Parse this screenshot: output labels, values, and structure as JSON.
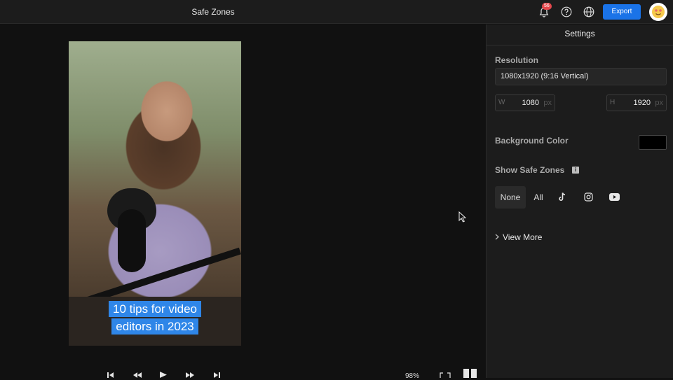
{
  "window": {
    "title": "Safe Zones"
  },
  "topbar": {
    "notification_count": "56",
    "export_label": "Export",
    "icons": [
      "bell-icon",
      "help-icon",
      "globe-icon"
    ],
    "accent_color": "#1a73e8"
  },
  "video": {
    "caption_line1": "10 tips for video",
    "caption_line2": "editors in 2023"
  },
  "playback": {
    "zoom": "98%"
  },
  "settings": {
    "header": "Settings",
    "resolution_label": "Resolution",
    "resolution_value": "1080x1920 (9:16 Vertical)",
    "width_prefix": "W",
    "width_value": "1080",
    "height_prefix": "H",
    "height_value": "1920",
    "unit": "px",
    "background_color_label": "Background Color",
    "background_color": "#000000",
    "safe_zones_label": "Show Safe Zones",
    "zone_options": [
      "None",
      "All"
    ],
    "zone_selected": "None",
    "view_more_label": "View More"
  }
}
